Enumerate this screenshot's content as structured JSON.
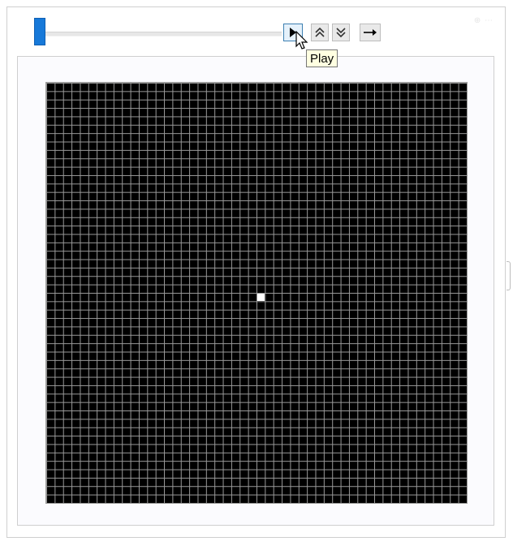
{
  "controls": {
    "slider": {
      "value_fraction": 0.0
    },
    "play_icon": "play-icon",
    "faster_icon": "double-chevron-up-icon",
    "slower_icon": "double-chevron-down-icon",
    "direction_icon": "arrow-right-icon",
    "tooltip": "Play"
  },
  "grid": {
    "rows": 50,
    "cols": 50,
    "on_cells": [
      {
        "row": 25,
        "col": 25
      }
    ],
    "off_color": "#000000",
    "on_color": "#ffffff",
    "line_color": "#9a9a9a"
  },
  "colors": {
    "accent": "#1779d9"
  }
}
